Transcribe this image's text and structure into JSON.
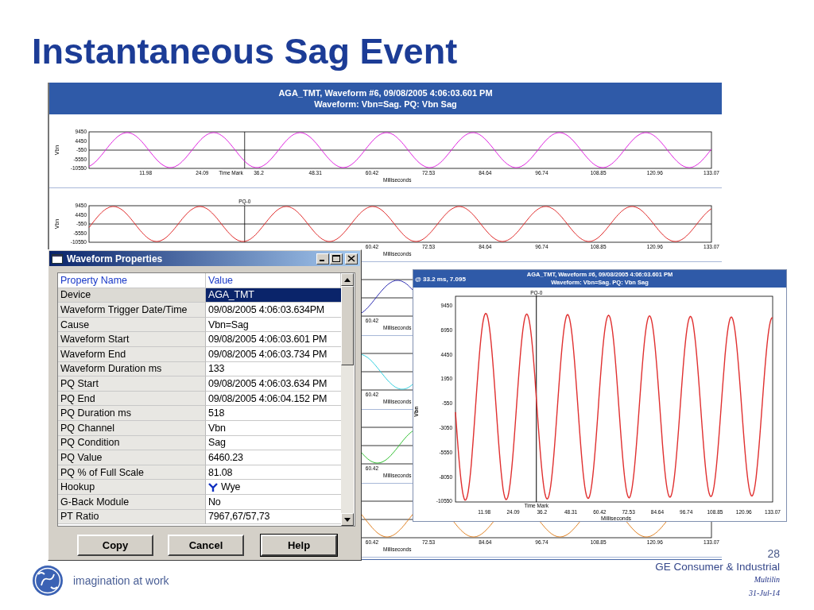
{
  "slide": {
    "title": "Instantaneous Sag Event",
    "tagline": "imagination at work",
    "page_number": "28",
    "company": "GE Consumer & Industrial",
    "division": "Multilin",
    "date": "31-Jul-14"
  },
  "waveform_window": {
    "header": [
      "AGA_TMT, Waveform #6, 09/08/2005 4:06:03.601 PM",
      "Waveform: Vbn=Sag. PQ: Vbn Sag"
    ],
    "strips": [
      {
        "color": "#e020e0",
        "y_label": "Vbn",
        "y_ticks": [
          "9450",
          "4450",
          "-550",
          "-5550",
          "-10550"
        ],
        "x_ticks": [
          "11.98",
          "24.09",
          "36.2",
          "48.31",
          "60.42",
          "72.53",
          "84.64",
          "96.74",
          "108.85",
          "120.96",
          "133.07"
        ],
        "x_label": "Milliseconds",
        "cursor_labels": [
          {
            "text": "Time Mark",
            "kind": "bottom"
          }
        ]
      },
      {
        "color": "#e02828",
        "y_label": "Vbn",
        "y_ticks": [
          "9450",
          "4450",
          "-550",
          "-5550",
          "-10550"
        ],
        "x_ticks": [
          "60.42",
          "72.53",
          "84.64",
          "96.74",
          "108.85",
          "120.96",
          "133.07"
        ],
        "x_label": "Milliseconds",
        "cursor_labels": [
          {
            "text": "PQ-0",
            "kind": "top"
          }
        ]
      },
      {
        "color": "#2828b0",
        "x_ticks": [
          "60.42"
        ],
        "x_label": "Milliseconds"
      },
      {
        "color": "#30d0e0",
        "x_ticks": [
          "60.42"
        ],
        "x_label": "Milliseconds"
      },
      {
        "color": "#30c030",
        "x_ticks": [
          "60.42"
        ],
        "x_label": "Milliseconds"
      },
      {
        "color": "#e08020",
        "x_ticks": [
          "60.42",
          "72.53",
          "84.64",
          "96.74",
          "108.85",
          "120.96",
          "133.07"
        ],
        "x_label": "Milliseconds"
      }
    ]
  },
  "properties_dialog": {
    "title": "Waveform Properties",
    "columns": [
      "Property Name",
      "Value"
    ],
    "rows": [
      {
        "name": "Device",
        "value": "AGA_TMT",
        "kind": "text",
        "selected": true
      },
      {
        "name": "Waveform Trigger Date/Time",
        "value": "09/08/2005 4:06:03.634PM",
        "kind": "text",
        "selected": false
      },
      {
        "name": "Cause",
        "value": "Vbn=Sag",
        "kind": "text",
        "selected": false
      },
      {
        "name": "Waveform Start",
        "value": "09/08/2005 4:06:03.601 PM",
        "kind": "text",
        "selected": false
      },
      {
        "name": "Waveform End",
        "value": "09/08/2005 4:06:03.734 PM",
        "kind": "text",
        "selected": false
      },
      {
        "name": "Waveform Duration ms",
        "value": "133",
        "kind": "text",
        "selected": false
      },
      {
        "name": "PQ Start",
        "value": "09/08/2005 4:06:03.634 PM",
        "kind": "text",
        "selected": false
      },
      {
        "name": "PQ End",
        "value": "09/08/2005 4:06:04.152 PM",
        "kind": "text",
        "selected": false
      },
      {
        "name": "PQ Duration ms",
        "value": "518",
        "kind": "text",
        "selected": false
      },
      {
        "name": "PQ Channel",
        "value": "Vbn",
        "kind": "text",
        "selected": false
      },
      {
        "name": "PQ Condition",
        "value": "Sag",
        "kind": "text",
        "selected": false
      },
      {
        "name": "PQ Value",
        "value": "6460.23",
        "kind": "text",
        "selected": false
      },
      {
        "name": "PQ % of Full Scale",
        "value": "81.08",
        "kind": "text",
        "selected": false
      },
      {
        "name": "Hookup",
        "value": "Wye",
        "kind": "wye",
        "selected": false
      },
      {
        "name": "G-Back Module",
        "value": "No",
        "kind": "text",
        "selected": false
      },
      {
        "name": "PT Ratio",
        "value": "7967,67/57,73",
        "kind": "text",
        "selected": false
      }
    ],
    "buttons": [
      {
        "label": "Copy",
        "default": false
      },
      {
        "label": "Cancel",
        "default": false
      },
      {
        "label": "Help",
        "default": true
      }
    ]
  },
  "zoom_window": {
    "readout": "@ 33.2 ms, 7.095",
    "header": [
      "AGA_TMT, Waveform #6, 09/08/2005 4:06:03.601 PM",
      "Waveform: Vbn=Sag. PQ: Vbn Sag"
    ],
    "color": "#e03030",
    "y_label": "Vbn",
    "y_ticks": [
      "9450",
      "6950",
      "4450",
      "1950",
      "-550",
      "-3050",
      "-5550",
      "-8050",
      "-10550"
    ],
    "x_ticks": [
      "11.98",
      "24.09",
      "36.2",
      "48.31",
      "60.42",
      "72.53",
      "84.64",
      "96.74",
      "108.85",
      "120.96",
      "133.07"
    ],
    "x_label": "Milliseconds",
    "cursor_labels": [
      {
        "text": "PQ-0",
        "kind": "top"
      },
      {
        "text": "Time Mark",
        "kind": "bottom"
      }
    ]
  }
}
